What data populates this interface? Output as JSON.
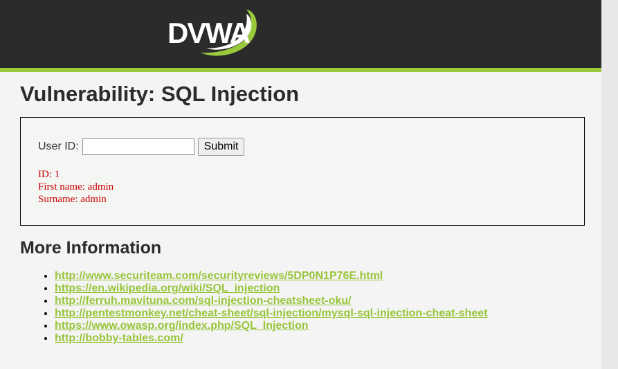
{
  "header": {
    "logo_text": "DVWA",
    "colors": {
      "bar": "#2b2b2b",
      "accent": "#9bc93c"
    }
  },
  "main": {
    "title": "Vulnerability: SQL Injection",
    "form": {
      "userid_label": "User ID:",
      "userid_value": "",
      "submit_label": "Submit"
    },
    "result": {
      "lines": [
        "ID: 1",
        "First name: admin",
        "Surname: admin"
      ],
      "color": "#cc0000"
    },
    "more_info": {
      "title": "More Information",
      "links": [
        "http://www.securiteam.com/securityreviews/5DP0N1P76E.html",
        "https://en.wikipedia.org/wiki/SQL_injection",
        "http://ferruh.mavituna.com/sql-injection-cheatsheet-oku/",
        "http://pentestmonkey.net/cheat-sheet/sql-injection/mysql-sql-injection-cheat-sheet",
        "https://www.owasp.org/index.php/SQL_Injection",
        "http://bobby-tables.com/"
      ]
    }
  }
}
